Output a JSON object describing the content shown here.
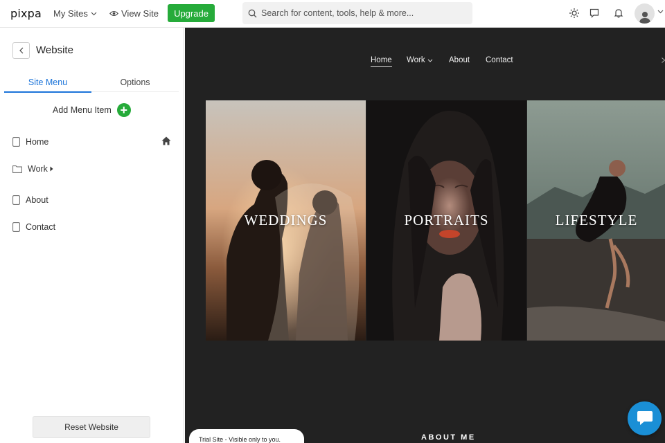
{
  "topbar": {
    "logo": "pixpa",
    "my_sites_label": "My Sites",
    "view_site_label": "View Site",
    "upgrade_label": "Upgrade",
    "search_placeholder": "Search for content, tools, help & more..."
  },
  "sidebar": {
    "title": "Website",
    "tabs": [
      {
        "label": "Site Menu"
      },
      {
        "label": "Options"
      }
    ],
    "add_menu_label": "Add Menu Item",
    "items": [
      {
        "label": "Home"
      },
      {
        "label": "Work"
      },
      {
        "label": "About"
      },
      {
        "label": "Contact"
      }
    ],
    "reset_label": "Reset Website"
  },
  "preview": {
    "nav": [
      {
        "label": "Home"
      },
      {
        "label": "Work"
      },
      {
        "label": "About"
      },
      {
        "label": "Contact"
      }
    ],
    "panels": [
      {
        "label": "WEDDINGS"
      },
      {
        "label": "PORTRAITS"
      },
      {
        "label": "LIFESTYLE"
      }
    ],
    "about_heading": "ABOUT ME",
    "trial_text": "Trial Site - Visible only to you."
  },
  "colors": {
    "accent": "#1a73d9",
    "upgrade_green": "#26ab3a",
    "preview_bg": "#222222",
    "chat_blue": "#1a8fd6"
  }
}
